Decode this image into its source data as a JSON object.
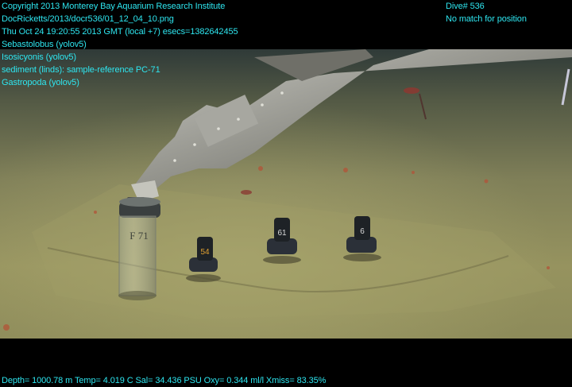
{
  "header_left": [
    "Copyright 2013 Monterey Bay Aquarium Research Institute",
    "DocRicketts/2013/docr536/01_12_04_10.png",
    "Thu Oct 24 19:20:55 2013 GMT (local +7)  esecs=1382642455",
    "Sebastolobus (yolov5)",
    "Isosicyonis (yolov5)",
    "sediment (linds): sample-reference PC-71",
    "Gastropoda (yolov5)"
  ],
  "header_right": [
    "Dive# 536",
    "No match for position"
  ],
  "footer": "Depth= 1000.78 m  Temp= 4.019 C  Sal= 34.436 PSU  Oxy= 0.344 ml/l  Xmiss= 83.35%",
  "core_labels": {
    "main_tube": "F 71",
    "core_1": "54",
    "core_2": "61",
    "core_3": "6"
  },
  "colors": {
    "overlay_text": "#2ee6f0",
    "seafloor": "#8e8f63",
    "water": "#2f3a3a"
  }
}
